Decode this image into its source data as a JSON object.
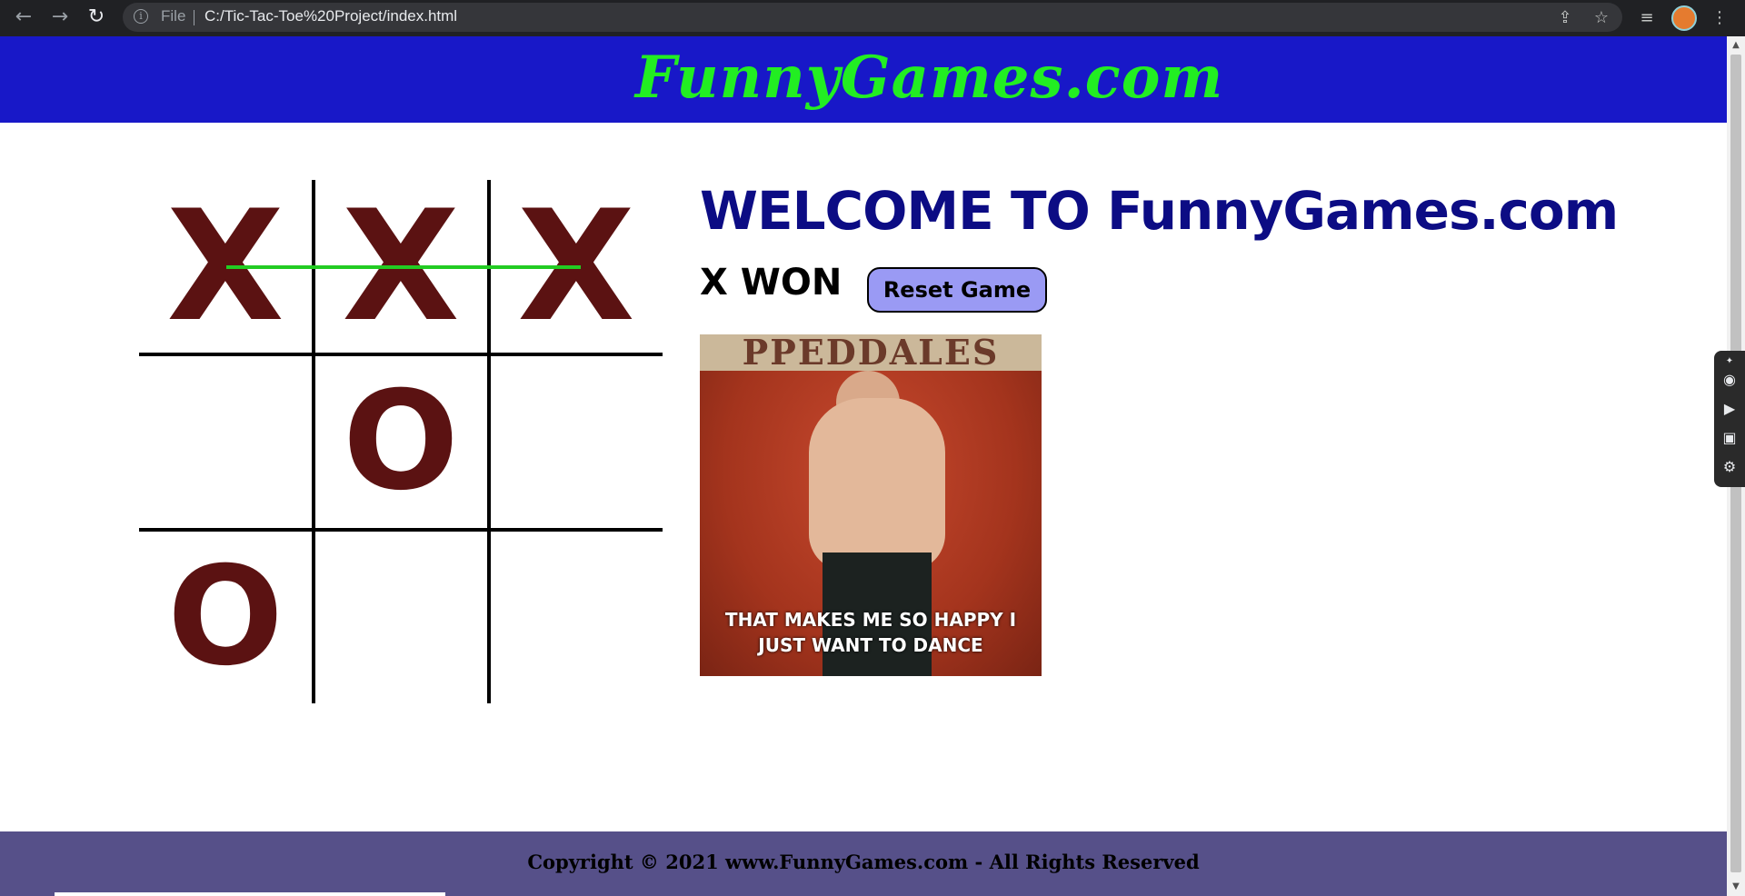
{
  "browser": {
    "file_label": "File",
    "url": "C:/Tic-Tac-Toe%20Project/index.html",
    "back_icon": "←",
    "forward_icon": "→",
    "reload_icon": "↻",
    "info_icon": "i",
    "share_icon": "⇪",
    "star_icon": "☆",
    "playlist_icon": "≡",
    "menu_icon": "⋮"
  },
  "header": {
    "logo": "FunnyGames.com"
  },
  "board": {
    "cells": [
      "X",
      "X",
      "X",
      "",
      "O",
      "",
      "O",
      "",
      ""
    ],
    "winning_line": "top-row"
  },
  "main": {
    "welcome": "WELCOME TO FunnyGames.com",
    "status": "X WON",
    "reset_label": "Reset Game",
    "gif": {
      "sign_text": "PPEDDALES",
      "caption_line1": "THAT MAKES ME SO HAPPY I",
      "caption_line2": "JUST WANT TO DANCE"
    }
  },
  "footer": {
    "text": "Copyright © 2021 www.FunnyGames.com - All Rights Reserved"
  },
  "side_widget": {
    "pin_icon": "✦",
    "camera_icon": "◉",
    "video_icon": "▶",
    "gallery_icon": "▣",
    "settings_icon": "⚙"
  },
  "colors": {
    "header_bg": "#1818c8",
    "logo": "#22ee22",
    "mark": "#5b1212",
    "win_line": "#22cc22",
    "welcome": "#0c0c84",
    "reset_bg": "#9a9af4",
    "footer_bg": "#565089"
  }
}
